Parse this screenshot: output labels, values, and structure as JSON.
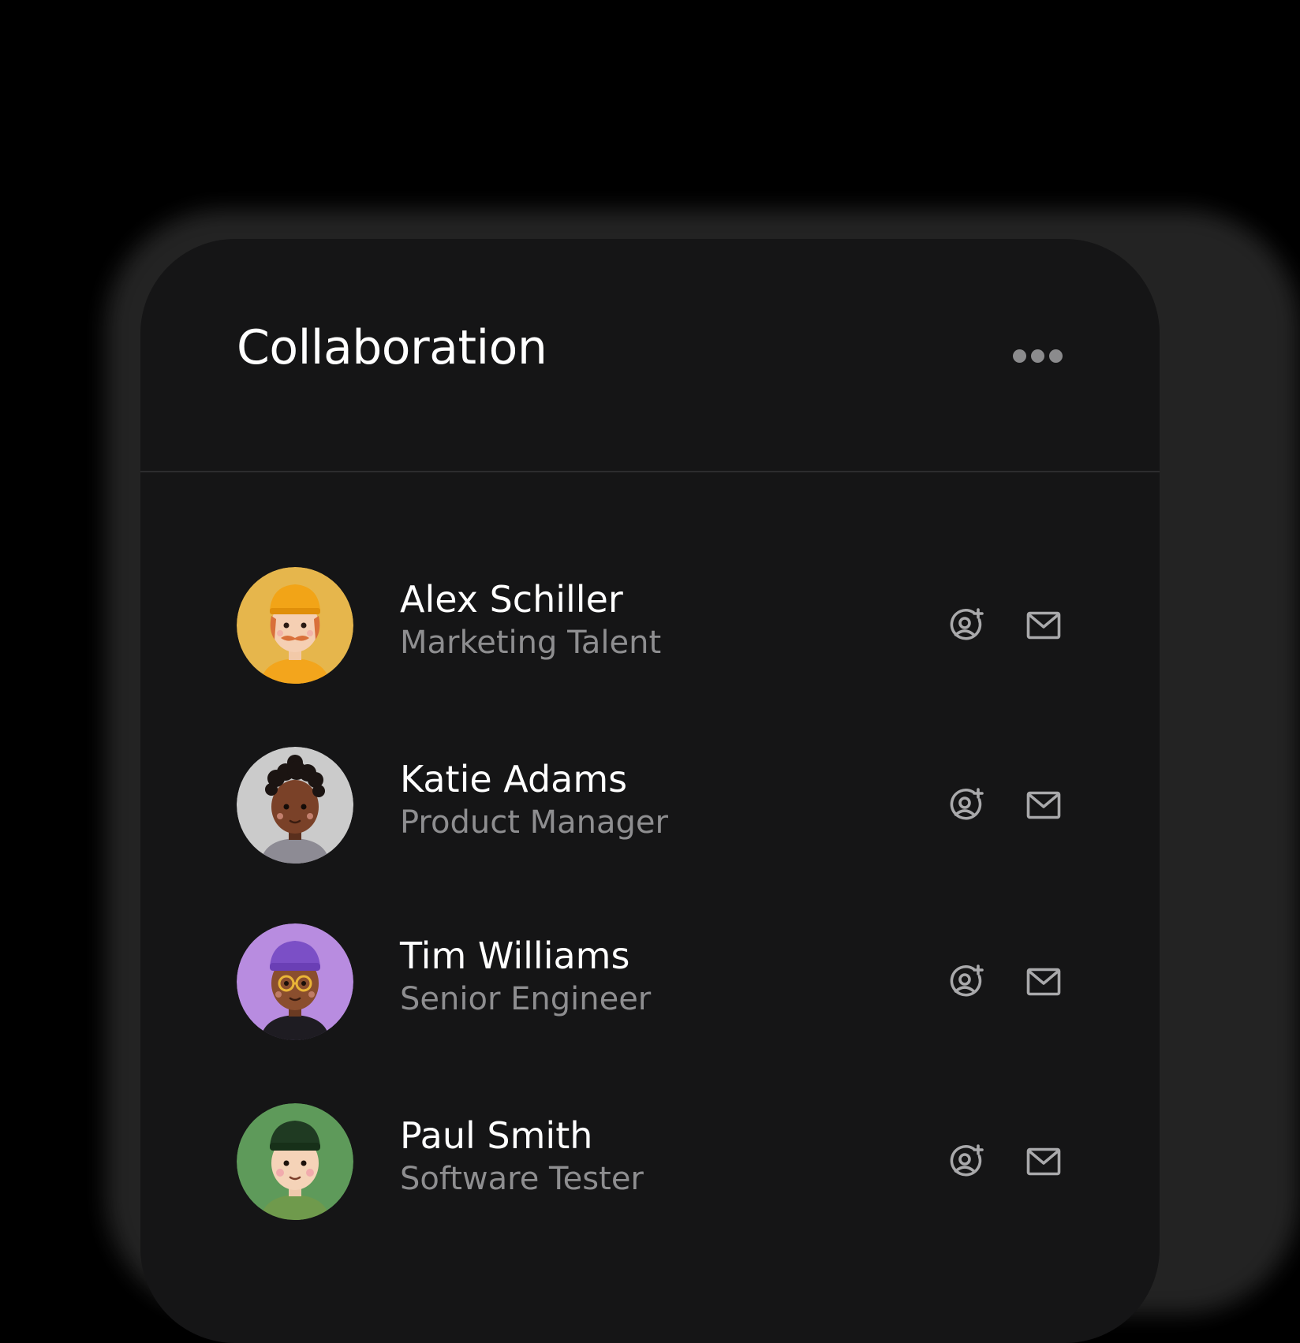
{
  "panel": {
    "title": "Collaboration",
    "menu_icon": "more-horizontal-icon"
  },
  "colors": {
    "page_background": "#000000",
    "card_background": "#151516",
    "title_text": "#ffffff",
    "secondary_text": "#8e8e90",
    "icon": "#a9a9ab",
    "divider": "#2c2c2e"
  },
  "people": [
    {
      "name": "Alex Schiller",
      "role": "Marketing Talent",
      "avatar_icon": "avatar-yellow-cap-icon",
      "avatar_bg": "#e8b84a",
      "actions": [
        "add-user-icon",
        "mail-icon"
      ]
    },
    {
      "name": "Katie Adams",
      "role": "Product Manager",
      "avatar_icon": "avatar-curly-hair-icon",
      "avatar_bg": "#c9c9c9",
      "actions": [
        "add-user-icon",
        "mail-icon"
      ]
    },
    {
      "name": "Tim Williams",
      "role": "Senior Engineer",
      "avatar_icon": "avatar-purple-beanie-glasses-icon",
      "avatar_bg": "#b98be0",
      "actions": [
        "add-user-icon",
        "mail-icon"
      ]
    },
    {
      "name": "Paul Smith",
      "role": "Software Tester",
      "avatar_icon": "avatar-green-beanie-icon",
      "avatar_bg": "#5e9a5a",
      "actions": [
        "add-user-icon",
        "mail-icon"
      ]
    }
  ]
}
